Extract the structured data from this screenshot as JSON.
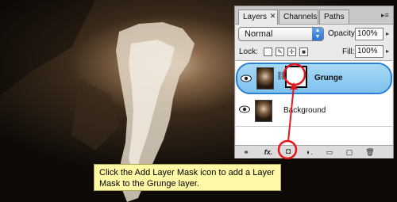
{
  "panel": {
    "tabs": [
      {
        "label": "Layers",
        "close": "✕"
      },
      {
        "label": "Channels"
      },
      {
        "label": "Paths"
      }
    ],
    "menu_glyph": "▸≡",
    "blend_mode": "Normal",
    "opacity_label": "Opacity:",
    "opacity_value": "100%",
    "lock_label": "Lock:",
    "fill_label": "Fill:",
    "fill_value": "100%",
    "layers": [
      {
        "name": "Grunge",
        "selected": true,
        "has_mask": true
      },
      {
        "name": "Background",
        "selected": false,
        "has_mask": false
      }
    ],
    "toolbar": {
      "link": "⚭",
      "fx": "fx.",
      "mask": "◘",
      "adjust": "◐.",
      "group": "▭",
      "new": "▢",
      "trash": "🗑"
    }
  },
  "callout": {
    "text": "Click the Add Layer Mask icon to add a Layer Mask to the Grunge layer."
  },
  "colors": {
    "highlight": "#e4141b",
    "callout_bg": "#fff9a6",
    "selected_layer": "#8ccbf0"
  }
}
